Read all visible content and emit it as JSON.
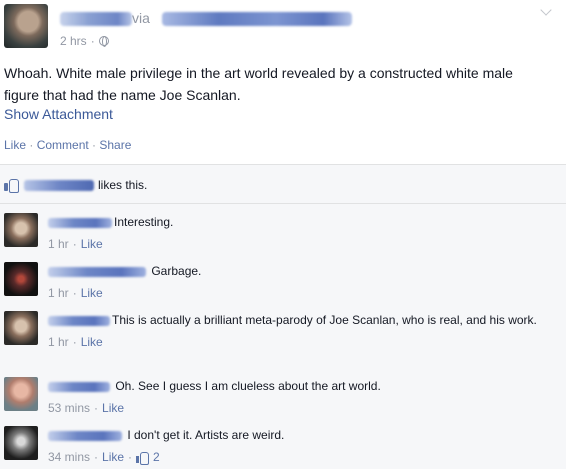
{
  "post": {
    "via_label": "via",
    "timestamp": "2 hrs",
    "separator": "·",
    "text": "Whoah. White male privilege in the art world revealed by a constructed white male figure that had the name Joe Scanlan.",
    "show_attachment": "Show Attachment",
    "actions": {
      "like": "Like",
      "comment": "Comment",
      "share": "Share",
      "dot": " · "
    }
  },
  "likes": {
    "text": "likes this."
  },
  "comments": [
    {
      "text": "Interesting.",
      "time": "1 hr",
      "like": "Like"
    },
    {
      "text": "Garbage.",
      "time": "1 hr",
      "like": "Like"
    },
    {
      "text": "This is actually a brilliant meta-parody of Joe Scanlan, who is real, and his work.",
      "time": "1 hr",
      "like": "Like"
    },
    {
      "text": "Oh. See I guess I am clueless about the art world.",
      "time": "53 mins",
      "like": "Like"
    },
    {
      "text": "I don't get it. Artists are weird.",
      "time": "34 mins",
      "like": "Like",
      "like_count": "2"
    }
  ],
  "colors": {
    "link": "#5b74a8",
    "accent": "#3b5998",
    "meta": "#9197a3",
    "text": "#141823",
    "feedback_bg": "#f6f7f9"
  },
  "icons": [
    "globe-icon",
    "chevron-down-icon",
    "thumbs-up-icon"
  ]
}
